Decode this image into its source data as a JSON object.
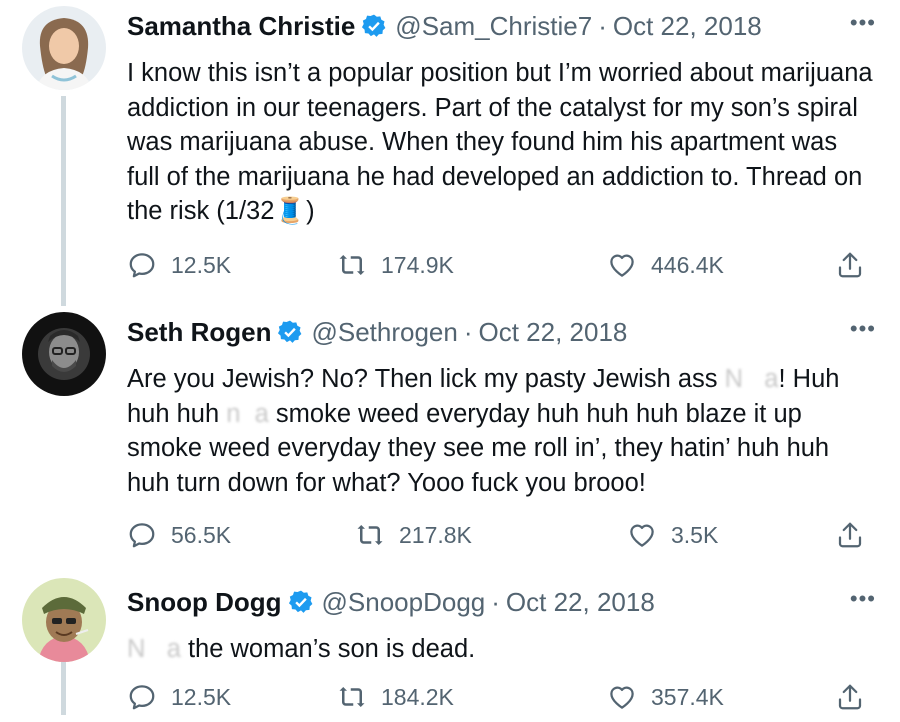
{
  "tweets": [
    {
      "name": "Samantha Christie",
      "handle": "@Sam_Christie7",
      "separator": "·",
      "date": "Oct 22, 2018",
      "more": "•••",
      "text_main": "I know this isn’t a popular position but I’m worried about marijuana addiction in our teenagers. Part of the catalyst for my son’s spiral was marijuana abuse. When they found him his apartment was full of the marijuana he had developed an addiction to. Thread on the risk (1/32",
      "thread_emoji": "🧵",
      "text_end": ")",
      "replies": "12.5K",
      "retweets": "174.9K",
      "likes": "446.4K"
    },
    {
      "name": "Seth Rogen",
      "handle": "@Sethrogen",
      "separator": "·",
      "date": "Oct 22, 2018",
      "more": "•••",
      "text_a": "Are you Jewish? No? Then lick my pasty Jewish ass ",
      "censored_1": "N",
      "censored_2": "a",
      "text_b": "! Huh huh huh ",
      "censored_3": "n",
      "censored_4": "a",
      "text_c": " smoke weed everyday huh huh huh blaze it up smoke weed everyday they see me roll in’, they hatin’ huh huh huh turn down for what? Yooo fuck you brooo!",
      "replies": "56.5K",
      "retweets": "217.8K",
      "likes": "3.5K"
    },
    {
      "name": "Snoop Dogg",
      "handle": "@SnoopDogg",
      "separator": "·",
      "date": "Oct 22, 2018",
      "more": "•••",
      "censored_1": "N",
      "censored_2": "a",
      "text_a": " the woman’s son is dead.",
      "replies": "12.5K",
      "retweets": "184.2K",
      "likes": "357.4K"
    }
  ],
  "icons": {
    "reply": "reply-icon",
    "retweet": "retweet-icon",
    "like": "heart-icon",
    "share": "share-icon",
    "verified": "verified-badge-icon"
  },
  "colors": {
    "verified": "#1d9bf0",
    "muted": "#536471",
    "thread_line": "#cfd9de"
  }
}
